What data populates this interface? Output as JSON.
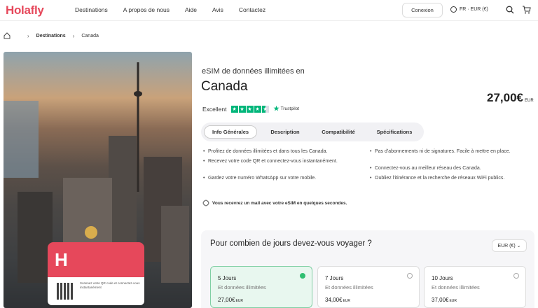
{
  "header": {
    "logo": "Holafly",
    "nav": [
      "Destinations",
      "A propos de nous",
      "Aide",
      "Avis",
      "Contactez"
    ],
    "login": "Conexion",
    "lang": "FR · EUR (€)"
  },
  "breadcrumb": {
    "item1": "Destinations",
    "item2": "Canada"
  },
  "product": {
    "subtitle": "eSIM de données illimitées en",
    "title": "Canada",
    "price": "27,00€",
    "price_currency": "EUR",
    "rating_label": "Excellent",
    "rating_stars": 4.5,
    "trustpilot": "Trustpilot"
  },
  "tabs": [
    "Info Générales",
    "Description",
    "Compatibilité",
    "Spécifications"
  ],
  "features": [
    "Profitez de données illimitées et dans tous les Canada.",
    "Recevez votre code QR et connectez-vous instantanément.",
    "Gardez votre numéro WhatsApp sur votre mobile.",
    "Pas d'abonnements ni de signatures. Facile à mettre en place.",
    "Connectez-vous au meilleur réseau des Canada.",
    "Oubliez l'itinérance et la recherche de réseaux WiFi publics."
  ],
  "mail_note": "Vous recevrez un mail avec votre eSIM en quelques secondes.",
  "esim_card": {
    "mark": "H",
    "qr_text": "Scannez votre QR code et connectez-vous instantanément"
  },
  "days_panel": {
    "title": "Pour combien de jours devez-vous voyager ?",
    "currency": "EUR (€)",
    "plans": [
      {
        "days": "5 Jours",
        "sub": "Et données illimitées",
        "price": "27,00€",
        "cur": "EUR",
        "selected": true
      },
      {
        "days": "7 Jours",
        "sub": "Et données illimitées",
        "price": "34,00€",
        "cur": "EUR",
        "selected": false
      },
      {
        "days": "10 Jours",
        "sub": "Et données illimitées",
        "price": "37,00€",
        "cur": "EUR",
        "selected": false
      }
    ]
  },
  "colors": {
    "brand": "#e6485b",
    "accent": "#00b67a",
    "selected_card": "#e8f7ef"
  }
}
